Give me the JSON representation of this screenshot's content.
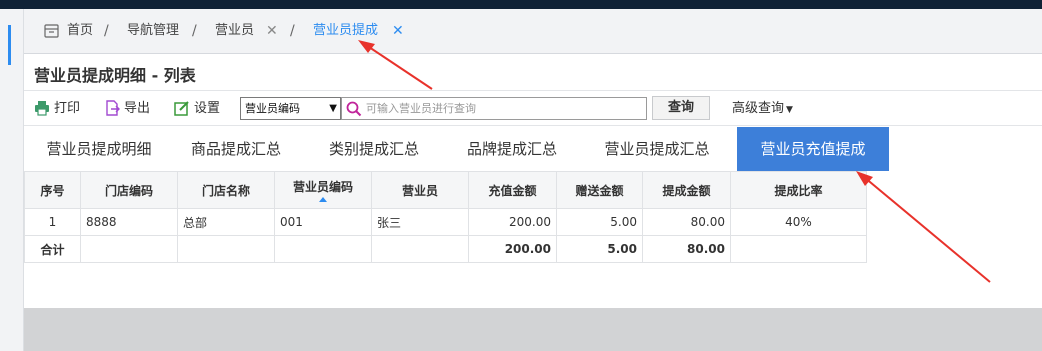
{
  "breadcrumb": {
    "items": [
      {
        "label": "首页"
      },
      {
        "label": "导航管理"
      },
      {
        "label": "营业员"
      },
      {
        "label": "营业员提成"
      }
    ]
  },
  "page": {
    "title": "营业员提成明细 - 列表"
  },
  "toolbar": {
    "print_label": "打印",
    "export_label": "导出",
    "settings_label": "设置",
    "select_value": "营业员编码",
    "search_placeholder": "可输入营业员进行查询",
    "query_label": "查询",
    "advanced_label": "高级查询"
  },
  "tabs": [
    {
      "label": "营业员提成明细"
    },
    {
      "label": "商品提成汇总"
    },
    {
      "label": "类别提成汇总"
    },
    {
      "label": "品牌提成汇总"
    },
    {
      "label": "营业员提成汇总"
    },
    {
      "label": "营业员充值提成",
      "active": true
    }
  ],
  "table": {
    "columns": [
      "序号",
      "门店编码",
      "门店名称",
      "营业员编码",
      "营业员",
      "充值金额",
      "赠送金额",
      "提成金额",
      "提成比率"
    ],
    "rows": [
      [
        "1",
        "8888",
        "总部",
        "001",
        "张三",
        "200.00",
        "5.00",
        "80.00",
        "40%"
      ]
    ],
    "total": [
      "合计",
      "",
      "",
      "",
      "",
      "200.00",
      "5.00",
      "80.00",
      ""
    ]
  },
  "colors": {
    "accent": "#2d8cf0",
    "active_tab": "#3d7fd9",
    "annotation": "#e8322b",
    "header_bar": "#102236"
  }
}
